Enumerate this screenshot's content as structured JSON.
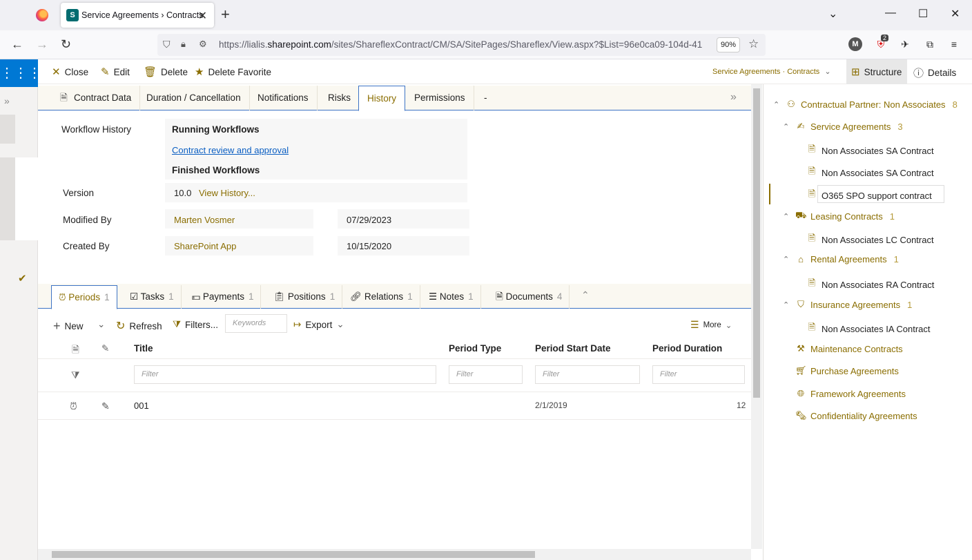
{
  "browser": {
    "tab_title": "Service Agreements › Contracts",
    "favicon_letter": "S",
    "url_prefix": "https://lialis.",
    "url_domain": "sharepoint.com",
    "url_path": "/sites/ShareflexContract/CM/SA/SitePages/Shareflex/View.aspx?$List=96e0ca09-104d-41",
    "zoom": "90%",
    "extension_badge": "2",
    "account_initial": "M"
  },
  "commandbar": {
    "close": "Close",
    "edit": "Edit",
    "delete": "Delete",
    "delete_favorite": "Delete Favorite",
    "breadcrumb": "Service Agreements · Contracts",
    "structure": "Structure",
    "details": "Details"
  },
  "form_tabs": [
    "Contract Data",
    "Duration / Cancellation",
    "Notifications",
    "Risks",
    "History",
    "Permissions",
    "-"
  ],
  "active_form_tab": "History",
  "history": {
    "workflow_history_label": "Workflow History",
    "running_workflows": "Running Workflows",
    "running_workflow_link": "Contract review and approval",
    "finished_workflows": "Finished Workflows",
    "version_label": "Version",
    "version_value": "10.0",
    "view_history": "View History...",
    "modified_by_label": "Modified By",
    "modified_by": "Marten Vosmer",
    "modified_date": "07/29/2023",
    "created_by_label": "Created By",
    "created_by": "SharePoint App",
    "created_date": "10/15/2020"
  },
  "sub_tabs": [
    {
      "label": "Periods",
      "count": "1"
    },
    {
      "label": "Tasks",
      "count": "1"
    },
    {
      "label": "Payments",
      "count": "1"
    },
    {
      "label": "Positions",
      "count": "1"
    },
    {
      "label": "Relations",
      "count": "1"
    },
    {
      "label": "Notes",
      "count": "1"
    },
    {
      "label": "Documents",
      "count": "4"
    }
  ],
  "toolbar": {
    "new": "New",
    "refresh": "Refresh",
    "filters": "Filters...",
    "keywords_placeholder": "Keywords",
    "export": "Export",
    "more": "More"
  },
  "grid": {
    "columns": [
      "Title",
      "Period Type",
      "Period Start Date",
      "Period Duration"
    ],
    "filter_placeholder": "Filter",
    "rows": [
      {
        "title": "001",
        "period_type": "",
        "period_start_date": "2/1/2019",
        "period_duration": "12"
      }
    ]
  },
  "tree": {
    "root": {
      "label": "Contractual Partner: Non Associates",
      "count": "8"
    },
    "service_agreements": {
      "label": "Service Agreements",
      "count": "3"
    },
    "sa_items": [
      "Non Associates SA Contract",
      "Non Associates SA Contract",
      "O365 SPO support contract"
    ],
    "leasing": {
      "label": "Leasing Contracts",
      "count": "1"
    },
    "lc_item": "Non Associates LC Contract",
    "rental": {
      "label": "Rental Agreements",
      "count": "1"
    },
    "ra_item": "Non Associates RA Contract",
    "insurance": {
      "label": "Insurance Agreements",
      "count": "1"
    },
    "ia_item": "Non Associates IA Contract",
    "maintenance": "Maintenance Contracts",
    "purchase": "Purchase Agreements",
    "framework": "Framework Agreements",
    "confidentiality": "Confidentiality Agreements"
  },
  "colors": {
    "accent": "#8a6d00",
    "tab_border": "#3d73c4",
    "waffle": "#0078d4",
    "link": "#0a5ec2"
  }
}
